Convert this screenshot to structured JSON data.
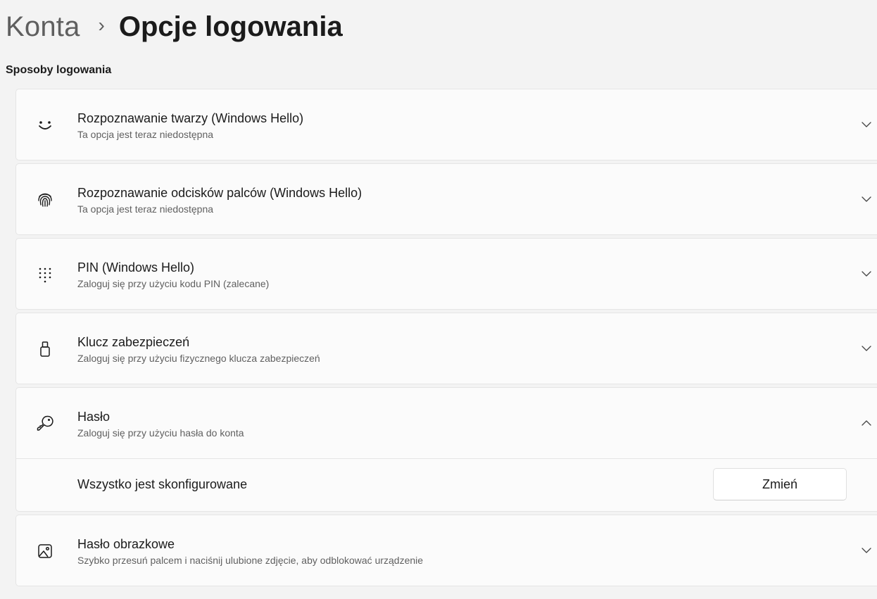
{
  "breadcrumb": {
    "parent": "Konta",
    "separator": "›",
    "current": "Opcje logowania"
  },
  "section": {
    "title": "Sposoby logowania"
  },
  "sign_in_options": [
    {
      "icon": "face-icon",
      "title": "Rozpoznawanie twarzy (Windows Hello)",
      "description": "Ta opcja jest teraz niedostępna",
      "expanded": false
    },
    {
      "icon": "fingerprint-icon",
      "title": "Rozpoznawanie odcisków palców (Windows Hello)",
      "description": "Ta opcja jest teraz niedostępna",
      "expanded": false
    },
    {
      "icon": "pin-keypad-icon",
      "title": "PIN (Windows Hello)",
      "description": "Zaloguj się przy użyciu kodu PIN (zalecane)",
      "expanded": false
    },
    {
      "icon": "security-key-icon",
      "title": "Klucz zabezpieczeń",
      "description": "Zaloguj się przy użyciu fizycznego klucza zabezpieczeń",
      "expanded": false
    },
    {
      "icon": "key-icon",
      "title": "Hasło",
      "description": "Zaloguj się przy użyciu hasła do konta",
      "expanded": true,
      "status": "Wszystko jest skonfigurowane",
      "action_label": "Zmień"
    },
    {
      "icon": "picture-icon",
      "title": "Hasło obrazkowe",
      "description": "Szybko przesuń palcem i naciśnij ulubione zdjęcie, aby odblokować urządzenie",
      "expanded": false
    }
  ]
}
